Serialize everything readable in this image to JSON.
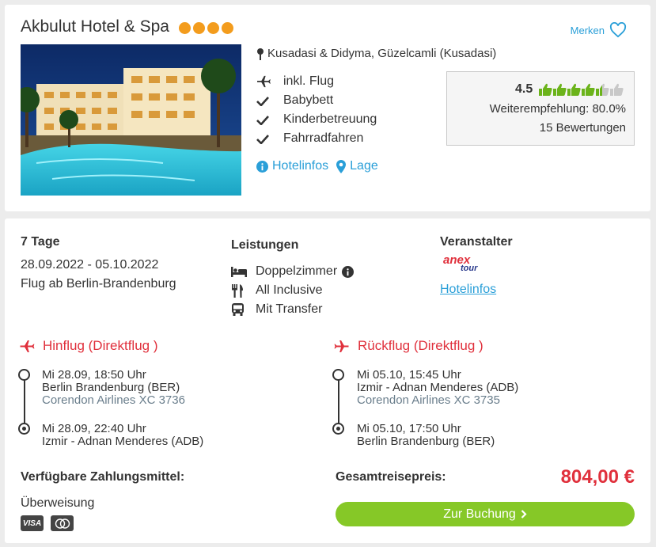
{
  "hotel": {
    "name": "Akbulut Hotel & Spa",
    "star_count": 4,
    "merken_label": "Merken",
    "location": "Kusadasi & Didyma, Güzelcamli (Kusadasi)",
    "features": [
      "inkl. Flug",
      "Babybett",
      "Kinderbetreuung",
      "Fahrradfahren"
    ],
    "links": {
      "hotelinfos": "Hotelinfos",
      "lage": "Lage"
    },
    "rating": {
      "score": "4.5",
      "thumbs_filled": 4.5,
      "recommendation": "Weiterempfehlung: 80.0%",
      "reviews": "15 Bewertungen"
    }
  },
  "offer": {
    "duration": "7 Tage",
    "dates": "28.09.2022 - 05.10.2022",
    "departure": "Flug ab Berlin-Brandenburg",
    "leistungen_title": "Leistungen",
    "leistungen": [
      "Doppelzimmer",
      "All Inclusive",
      "Mit Transfer"
    ],
    "veranstalter_title": "Veranstalter",
    "veranstalter_logo_top": "anex",
    "veranstalter_logo_bottom": "tour",
    "veranstalter_link": "Hotelinfos"
  },
  "outbound": {
    "title": "Hinflug (Direktflug )",
    "dep_time": "Mi 28.09, 18:50 Uhr",
    "dep_airport": "Berlin Brandenburg (BER)",
    "airline": "Corendon Airlines XC 3736",
    "arr_time": "Mi 28.09, 22:40 Uhr",
    "arr_airport": "Izmir - Adnan Menderes (ADB)"
  },
  "return": {
    "title": "Rückflug (Direktflug )",
    "dep_time": "Mi 05.10, 15:45 Uhr",
    "dep_airport": "Izmir - Adnan Menderes (ADB)",
    "airline": "Corendon Airlines XC 3735",
    "arr_time": "Mi 05.10, 17:50 Uhr",
    "arr_airport": "Berlin Brandenburg (BER)"
  },
  "payment": {
    "title": "Verfügbare Zahlungsmittel:",
    "method": "Überweisung",
    "visa_label": "VISA"
  },
  "total": {
    "label": "Gesamtreisepreis:",
    "price": "804,00 €",
    "button_label": "Zur Buchung"
  },
  "colors": {
    "accent_blue": "#2a9fd8",
    "price_red": "#e0303c",
    "button_green": "#86c827",
    "star_orange": "#f39c1d",
    "thumb_green": "#6bb31a"
  }
}
